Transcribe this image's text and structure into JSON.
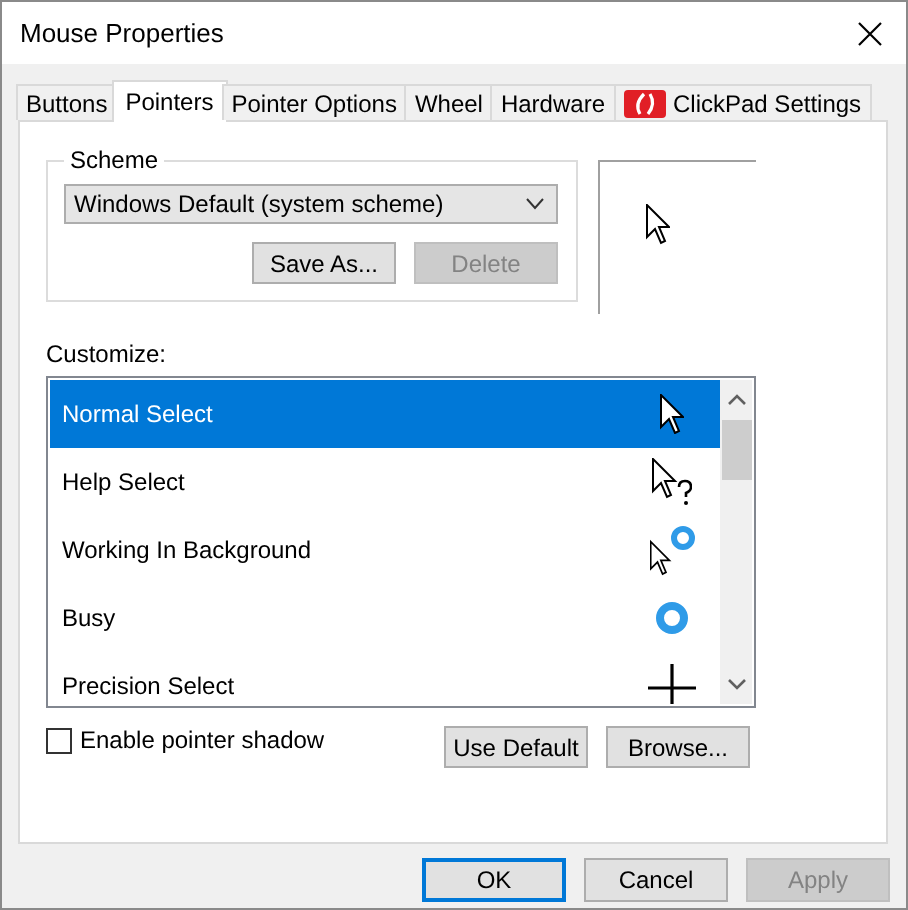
{
  "window": {
    "title": "Mouse Properties"
  },
  "tabs": [
    {
      "label": "Buttons",
      "selected": false,
      "kind": "plain"
    },
    {
      "label": "Pointers",
      "selected": true,
      "kind": "plain"
    },
    {
      "label": "Pointer Options",
      "selected": false,
      "kind": "plain"
    },
    {
      "label": "Wheel",
      "selected": false,
      "kind": "plain"
    },
    {
      "label": "Hardware",
      "selected": false,
      "kind": "plain"
    },
    {
      "label": "ClickPad Settings",
      "selected": false,
      "kind": "logo"
    }
  ],
  "scheme": {
    "legend": "Scheme",
    "value": "Windows Default (system scheme)",
    "buttons": [
      {
        "label": "Save As...",
        "disabled": false
      },
      {
        "label": "Delete",
        "disabled": true
      }
    ]
  },
  "preview": {
    "kind": "arrow"
  },
  "customize": {
    "label": "Customize:",
    "rows": [
      {
        "name": "Normal Select",
        "kind": "arrow",
        "selected": true
      },
      {
        "name": "Help Select",
        "kind": "help",
        "selected": false
      },
      {
        "name": "Working In Background",
        "kind": "working",
        "selected": false
      },
      {
        "name": "Busy",
        "kind": "busy",
        "selected": false
      },
      {
        "name": "Precision Select",
        "kind": "cross",
        "selected": false
      }
    ]
  },
  "shadow": {
    "label": "Enable pointer shadow",
    "checked": false
  },
  "pointer_buttons": [
    {
      "label": "Use Default"
    },
    {
      "label": "Browse..."
    }
  ],
  "dialog_buttons": [
    {
      "label": "OK",
      "default": true,
      "disabled": false
    },
    {
      "label": "Cancel",
      "default": false,
      "disabled": false
    },
    {
      "label": "Apply",
      "default": false,
      "disabled": true
    }
  ]
}
